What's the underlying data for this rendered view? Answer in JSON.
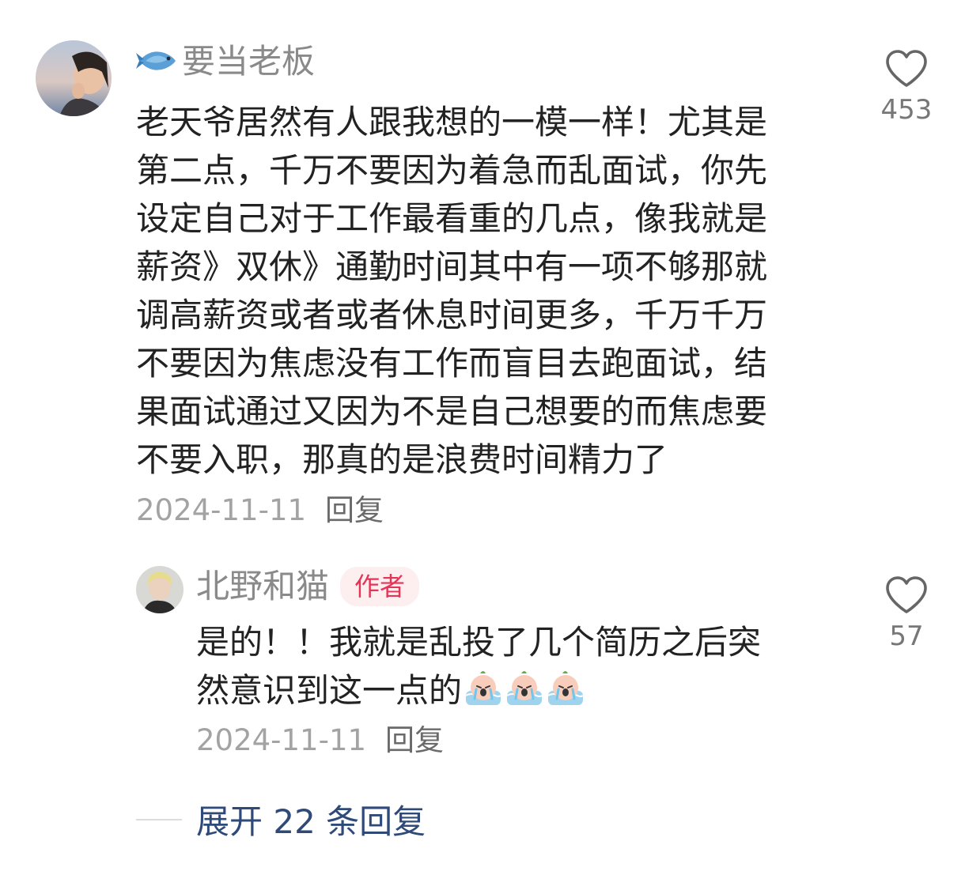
{
  "comment": {
    "username": "要当老板",
    "body_lines": [
      "老天爷居然有人跟我想的一模一样！尤其是",
      "第二点，千万不要因为着急而乱面试，你先",
      "设定自己对于工作最看重的几点，像我就是",
      "薪资》双休》通勤时间其中有一项不够那就",
      "调高薪资或者或者休息时间更多，千万千万",
      "不要因为焦虑没有工作而盲目去跑面试，结",
      "果面试通过又因为不是自己想要的而焦虑要",
      "不要入职，那真的是浪费时间精力了"
    ],
    "date": "2024-11-11",
    "reply_label": "回复",
    "like_count": "453",
    "icons": {
      "username_prefix": "fish-icon",
      "like": "heart-outline-icon"
    }
  },
  "reply": {
    "username": "北野和猫",
    "badge": "作者",
    "body_lines": [
      "是的！！我就是乱投了几个简历之后突",
      "然意识到这一点的"
    ],
    "emoji_count": 3,
    "emoji_name": "crying-face-emoji",
    "date": "2024-11-11",
    "reply_label": "回复",
    "like_count": "57"
  },
  "expand": {
    "label": "展开 22 条回复"
  },
  "colors": {
    "username": "#8a8a8a",
    "body": "#222222",
    "meta": "#a3a3a3",
    "badge_bg": "#fdeef0",
    "badge_text": "#e53557",
    "expand_link": "#2f4a78"
  }
}
